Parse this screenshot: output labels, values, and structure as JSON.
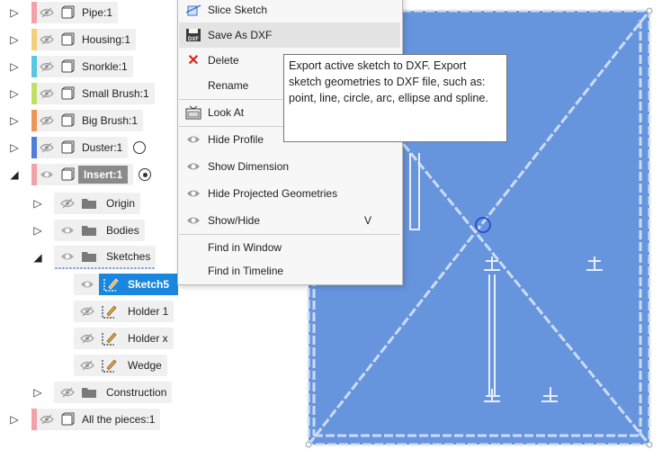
{
  "colors": {
    "canvas_blue": "#6795dd",
    "selection_blue": "#1a86dd",
    "pipe": "#f3a1a8",
    "housing": "#f5cf78",
    "snorkle": "#57c8e3",
    "small_brush": "#bfe064",
    "big_brush": "#f0955a",
    "duster": "#4f7ed8",
    "insert": "#f3a1a8",
    "all_pieces": "#f3a1a8"
  },
  "browser": {
    "components": [
      {
        "label": "Pipe:1",
        "color": "pipe"
      },
      {
        "label": "Housing:1",
        "color": "housing"
      },
      {
        "label": "Snorkle:1",
        "color": "snorkle"
      },
      {
        "label": "Small Brush:1",
        "color": "small_brush"
      },
      {
        "label": "Big Brush:1",
        "color": "big_brush"
      },
      {
        "label": "Duster:1",
        "color": "duster"
      }
    ],
    "insert": {
      "label": "Insert:1"
    },
    "folders": {
      "origin": "Origin",
      "bodies": "Bodies",
      "sketches": "Sketches",
      "construction": "Construction"
    },
    "sketches": [
      {
        "label": "Sketch5",
        "selected": true
      },
      {
        "label": "Holder 1"
      },
      {
        "label": "Holder x"
      },
      {
        "label": "Wedge"
      }
    ],
    "all_pieces": {
      "label": "All the pieces:1"
    }
  },
  "menu": {
    "items": [
      {
        "label": "Slice Sketch",
        "icon": "slice-sketch-icon",
        "shortcut": ""
      },
      {
        "label": "Save As DXF",
        "icon": "dxf-icon",
        "shortcut": "",
        "highlighted": true
      },
      {
        "label": "Delete",
        "icon": "delete-x-icon",
        "shortcut": ""
      },
      {
        "label": "Rename",
        "icon": "",
        "shortcut": ""
      },
      {
        "label": "Look At",
        "icon": "look-at-icon",
        "shortcut": ""
      },
      {
        "label": "Hide Profile",
        "icon": "eye-icon",
        "shortcut": ""
      },
      {
        "label": "Show Dimension",
        "icon": "eye-icon",
        "shortcut": ""
      },
      {
        "label": "Hide Projected Geometries",
        "icon": "eye-icon",
        "shortcut": ""
      },
      {
        "label": "Show/Hide",
        "icon": "eye-icon",
        "shortcut": "V"
      },
      {
        "label": "Find in Window",
        "icon": "",
        "shortcut": ""
      },
      {
        "label": "Find in Timeline",
        "icon": "",
        "shortcut": ""
      }
    ]
  },
  "tooltip": {
    "text": "Export active sketch to DXF. Export sketch geometries to DXF file, such as: point, line, circle, arc, ellipse and spline."
  }
}
